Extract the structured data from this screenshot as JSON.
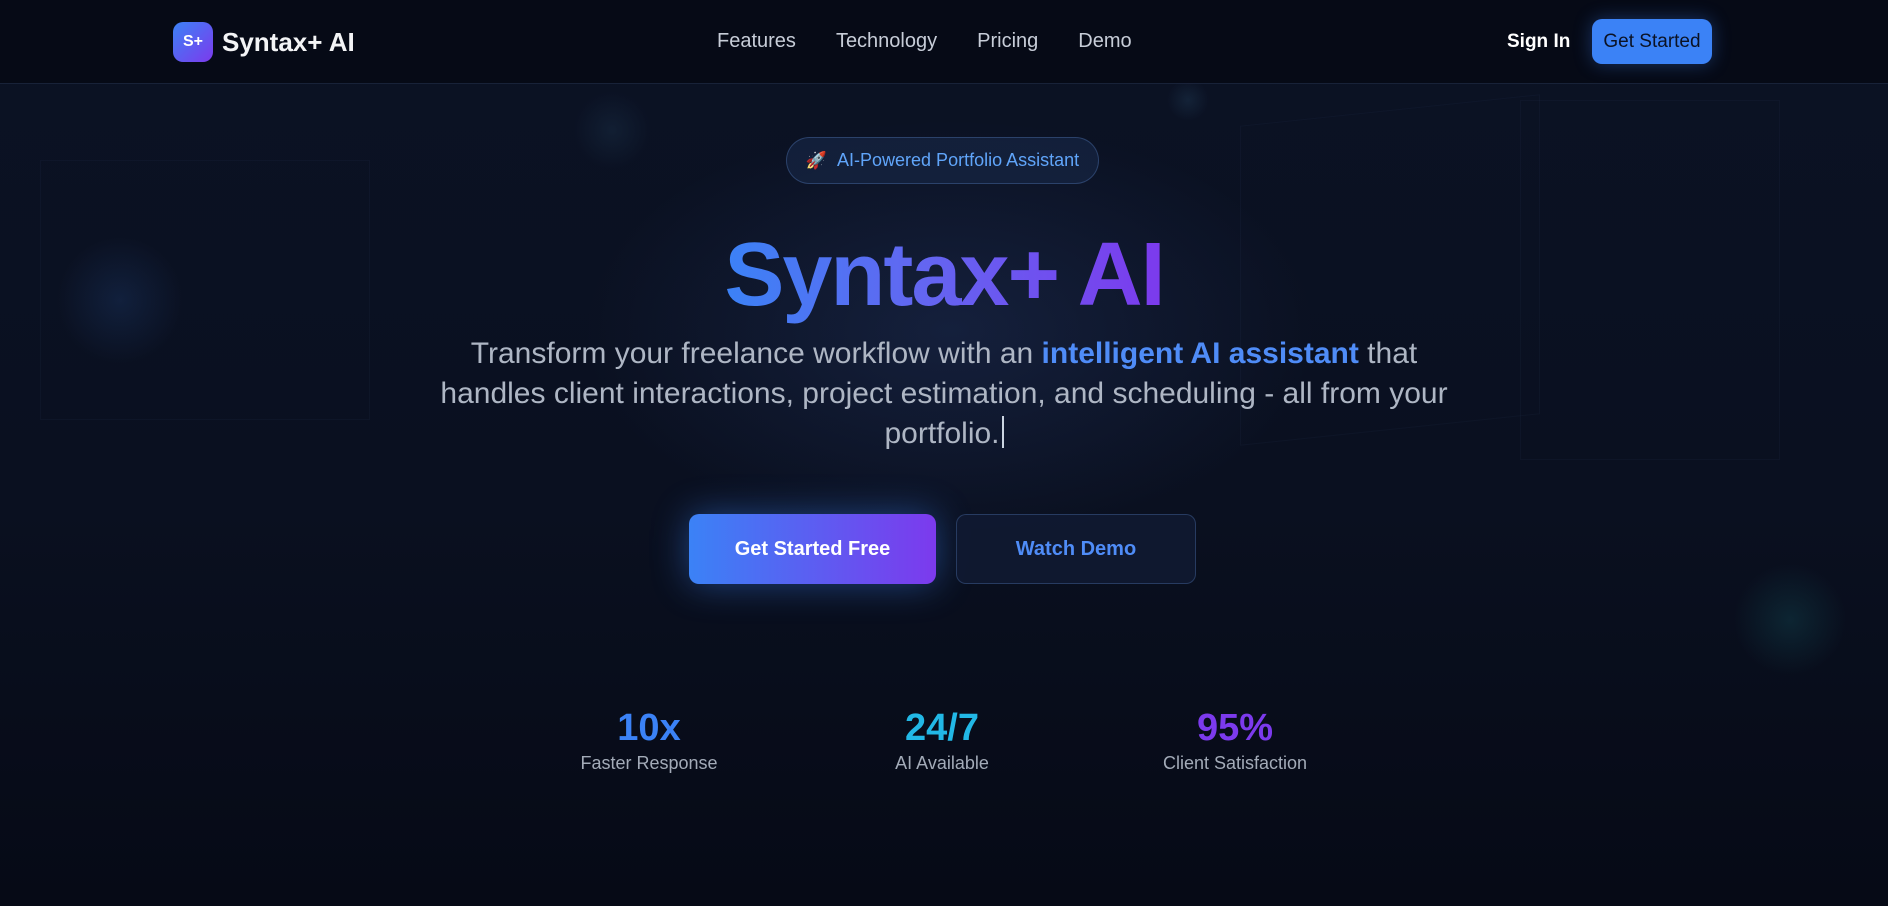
{
  "nav": {
    "logo_mark": "S+",
    "logo_text": "Syntax+ AI",
    "links": [
      "Features",
      "Technology",
      "Pricing",
      "Demo"
    ],
    "sign_in": "Sign In",
    "get_started": "Get Started"
  },
  "hero": {
    "badge_icon": "rocket-icon",
    "badge_text": "AI-Powered Portfolio Assistant",
    "title": "Syntax+ AI",
    "subtitle_before": "Transform your freelance workflow with an ",
    "subtitle_highlight": "intelligent AI assistant",
    "subtitle_after": " that handles client interactions, project estimation, and scheduling - all from your portfolio.",
    "primary_button": "Get Started Free",
    "secondary_button": "Watch Demo"
  },
  "stats": [
    {
      "value": "10x",
      "label": "Faster Response",
      "color": "#3b82f6"
    },
    {
      "value": "24/7",
      "label": "AI Available",
      "color": "#22b8e6"
    },
    {
      "value": "95%",
      "label": "Client Satisfaction",
      "color": "#7c3aed"
    }
  ],
  "colors": {
    "background": "#070b18",
    "accent_blue": "#3b82f6",
    "accent_purple": "#7c3aed"
  }
}
